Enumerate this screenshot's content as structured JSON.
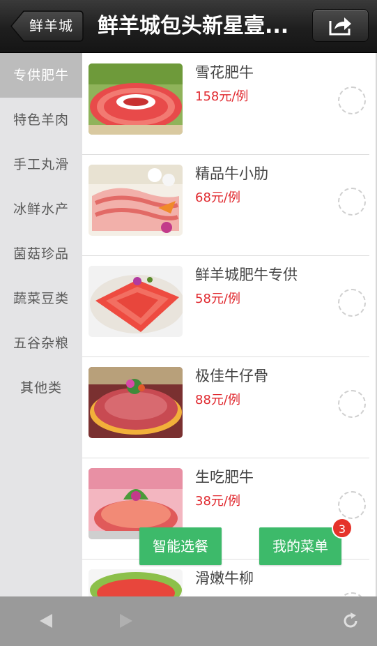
{
  "header": {
    "back_label": "鲜羊城",
    "title": "鲜羊城包头新星壹...",
    "share_icon": "share-icon"
  },
  "sidebar": {
    "items": [
      {
        "label": "专供肥牛",
        "active": true
      },
      {
        "label": "特色羊肉",
        "active": false
      },
      {
        "label": "手工丸滑",
        "active": false
      },
      {
        "label": "冰鲜水产",
        "active": false
      },
      {
        "label": "菌菇珍品",
        "active": false
      },
      {
        "label": "蔬菜豆类",
        "active": false
      },
      {
        "label": "五谷杂粮",
        "active": false
      },
      {
        "label": "其他类",
        "active": false
      }
    ]
  },
  "menu_items": [
    {
      "name": "雪花肥牛",
      "price": "158元/例"
    },
    {
      "name": "精品牛小肋",
      "price": "68元/例"
    },
    {
      "name": "鲜羊城肥牛专供",
      "price": "58元/例"
    },
    {
      "name": "极佳牛仔骨",
      "price": "88元/例"
    },
    {
      "name": "生吃肥牛",
      "price": "38元/例"
    },
    {
      "name": "滑嫩牛柳",
      "price": ""
    }
  ],
  "actions": {
    "smart_select": "智能选餐",
    "my_menu": "我的菜单",
    "my_menu_count": "3"
  },
  "bottom_bar": {
    "back_icon": "back-arrow-icon",
    "forward_icon": "forward-arrow-icon",
    "refresh_icon": "refresh-icon"
  },
  "colors": {
    "price": "#e0282e",
    "action_button": "#3dba6a",
    "badge": "#e5332a",
    "sidebar_active": "#bcbcbc"
  }
}
